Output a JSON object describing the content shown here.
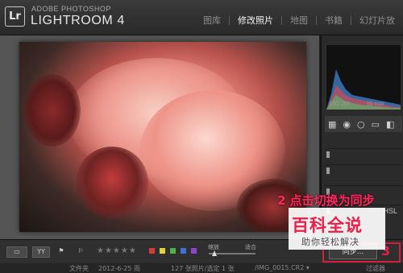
{
  "app": {
    "logo": "Lr",
    "brand_small": "ADOBE PHOTOSHOP",
    "brand_main": "LIGHTROOM 4"
  },
  "modules": [
    {
      "label": "图库",
      "active": false
    },
    {
      "label": "修改照片",
      "active": true
    },
    {
      "label": "地图",
      "active": false
    },
    {
      "label": "书籍",
      "active": false
    },
    {
      "label": "幻灯片放",
      "active": false
    }
  ],
  "histogram": {
    "iso": "ISO 200",
    "focal": "55 mm"
  },
  "panels": [
    {
      "label": "HSL"
    }
  ],
  "toolbar": {
    "stars": "★★★★★",
    "zoom_label": "缩放",
    "fit_label": "适合",
    "sync_label": "同步...",
    "colors": [
      "#d63b3b",
      "#e1d23a",
      "#4bb34b",
      "#3f6fd1",
      "#8b46c7"
    ]
  },
  "annotation": {
    "step2": "2 点击切换为同步",
    "step3": "3"
  },
  "filmstrip": {
    "text1": "文件夹",
    "text2": "2012-6-25 雨",
    "text3": "127 张照片/选定 1 张",
    "text4": "/IMG_0015.CR2 ▾",
    "filter": "过滤器"
  },
  "watermark": {
    "title": "百科全说",
    "subtitle": "助你轻松解决"
  }
}
